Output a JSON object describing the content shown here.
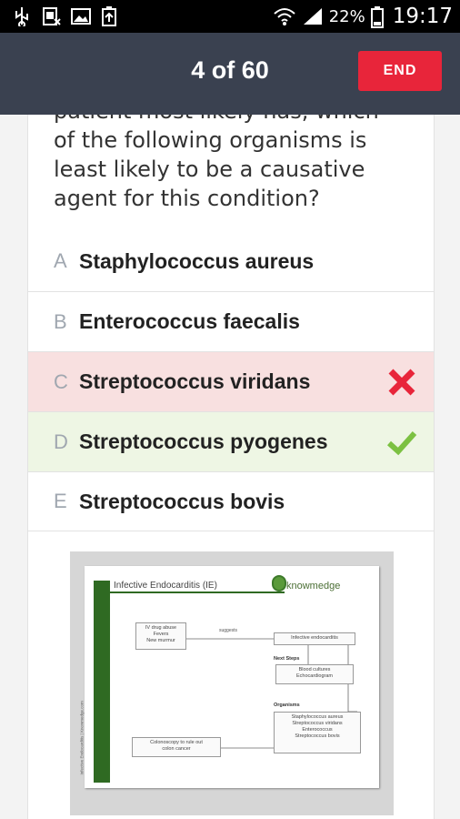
{
  "status_bar": {
    "battery": "22%",
    "time": "19:17",
    "icons": [
      "usb-icon",
      "sim-icon",
      "image-icon",
      "battery-saver-icon",
      "wifi-icon",
      "signal-icon",
      "battery-icon"
    ]
  },
  "header": {
    "progress": "4 of 60",
    "end_label": "END"
  },
  "question": {
    "clipped_line": "patient most likely has, which",
    "line1": "of the following organisms is",
    "line2": "least likely to be a causative",
    "line3": "agent for this condition?"
  },
  "answers": [
    {
      "letter": "A",
      "text": "Staphylococcus aureus",
      "state": "none"
    },
    {
      "letter": "B",
      "text": "Enterococcus faecalis",
      "state": "none"
    },
    {
      "letter": "C",
      "text": "Streptococcus viridans",
      "state": "wrong",
      "icon": "x-icon"
    },
    {
      "letter": "D",
      "text": "Streptococcus pyogenes",
      "state": "correct",
      "icon": "checkmark-icon"
    },
    {
      "letter": "E",
      "text": "Streptococcus bovis",
      "state": "none"
    }
  ],
  "colors": {
    "header_bg": "#3a4150",
    "end_button": "#e8253a",
    "wrong_bg": "#f8e0e0",
    "correct_bg": "#eef6e4",
    "wrong_icon": "#e8253a",
    "correct_icon": "#7cc142",
    "diagram_green": "#2f6a22"
  },
  "diagram": {
    "title": "Infective Endocarditis (IE)",
    "logo": "knowmedge",
    "side_label": "Infective Endocarditis | Knowmedge.com",
    "risk_box": [
      "IV drug abuse",
      "Fevers",
      "New murmur"
    ],
    "suggests_label": "suggests",
    "diagnosis_box": "Infective endocarditis",
    "next_steps_label": "Next Steps",
    "next_steps_box": [
      "Blood cultures",
      "Echocardiogram"
    ],
    "organisms_label": "Organisms",
    "organisms_box": [
      "Staphylococcus aureus",
      "Streptococcus viridans",
      "Enterococcus",
      "Streptococcus bovis"
    ],
    "colonoscopy_box": [
      "Colonoscopy to rule out",
      "colon cancer"
    ]
  }
}
